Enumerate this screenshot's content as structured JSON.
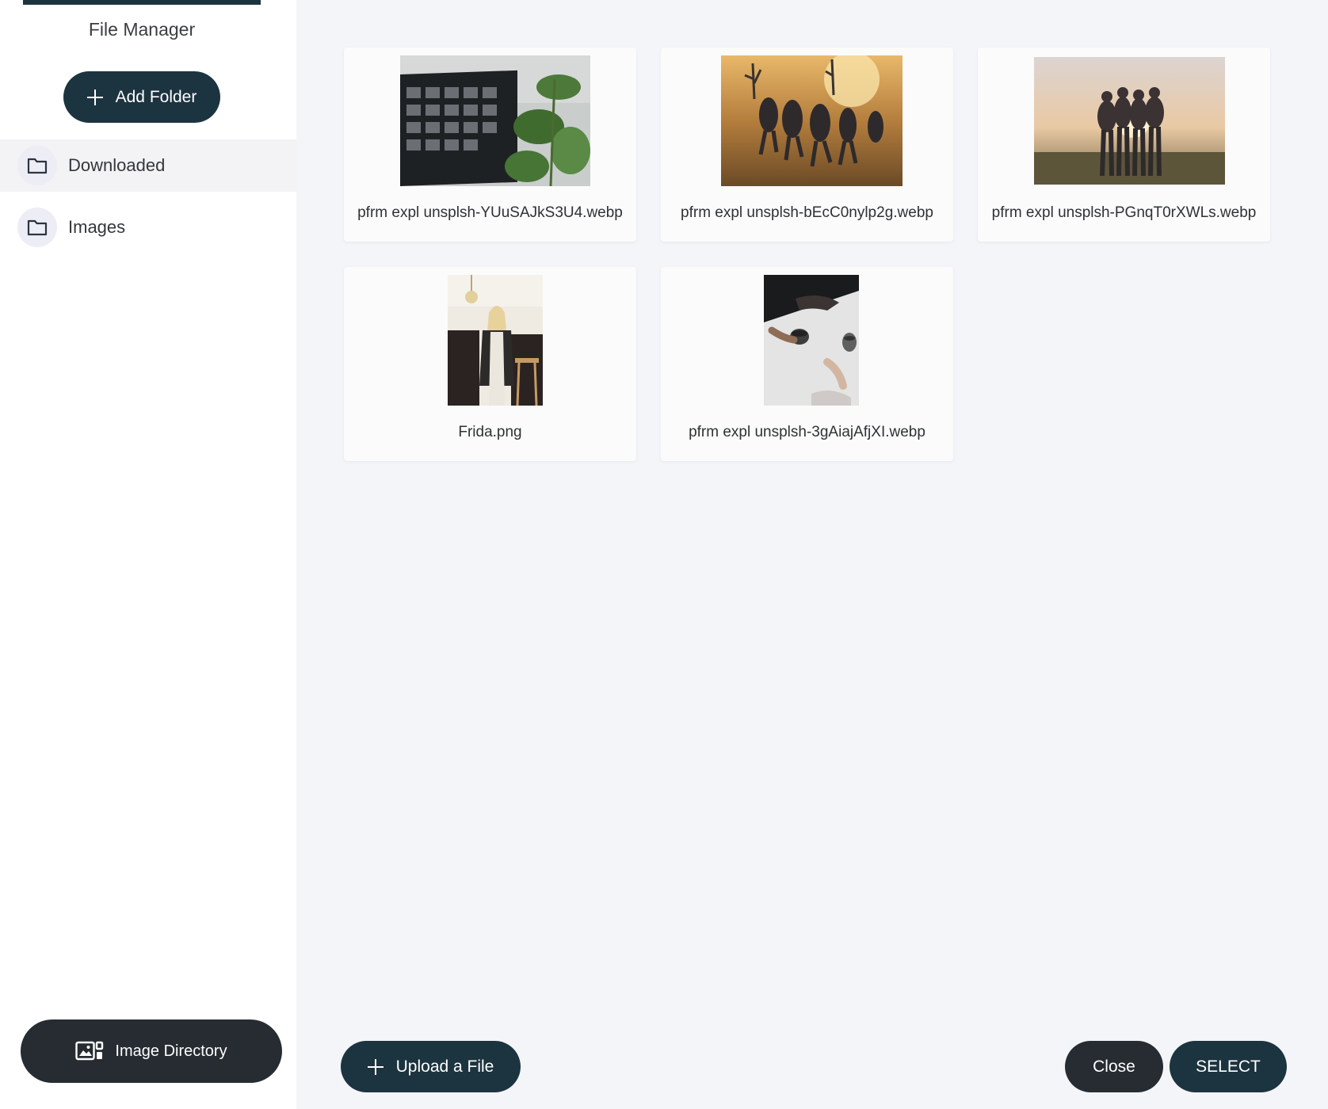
{
  "sidebar": {
    "title": "File Manager",
    "add_folder_label": "Add Folder",
    "folders": [
      {
        "label": "Downloaded",
        "active": true
      },
      {
        "label": "Images",
        "active": false
      }
    ],
    "image_directory_label": "Image Directory"
  },
  "files": [
    {
      "name": "pfrm expl unsplsh-YUuSAJkS3U4.webp",
      "thumb": "laptop-plant"
    },
    {
      "name": "pfrm expl unsplsh-bEcC0nylp2g.webp",
      "thumb": "desert-runners"
    },
    {
      "name": "pfrm expl unsplsh-PGnqT0rXWLs.webp",
      "thumb": "friends-sunset"
    },
    {
      "name": "Frida.png",
      "thumb": "woman-kitchen"
    },
    {
      "name": "pfrm expl unsplsh-3gAiajAfjXI.webp",
      "thumb": "coffee-table"
    }
  ],
  "footer": {
    "upload_label": "Upload a File",
    "close_label": "Close",
    "select_label": "SELECT"
  },
  "colors": {
    "primary": "#1c3440",
    "dark": "#262c32",
    "background": "#f4f5f9"
  }
}
